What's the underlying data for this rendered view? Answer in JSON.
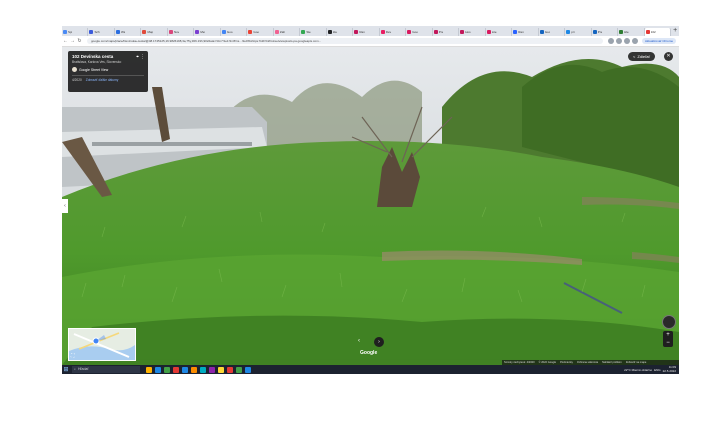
{
  "browser": {
    "tabs": [
      {
        "label": "Spi",
        "color": "#4a8af4",
        "active": false
      },
      {
        "label": "Sch",
        "color": "#3b5bdb",
        "active": false
      },
      {
        "label": "Wa",
        "color": "#2b6ee0",
        "active": false
      },
      {
        "label": "Map",
        "color": "#e04a3b",
        "active": false
      },
      {
        "label": "Nov",
        "color": "#d9467b",
        "active": false
      },
      {
        "label": "Met",
        "color": "#7b3fd1",
        "active": false
      },
      {
        "label": "Goo",
        "color": "#4285f4",
        "active": false
      },
      {
        "label": "Goo",
        "color": "#ea4335",
        "active": false
      },
      {
        "label": "Zah",
        "color": "#f06292",
        "active": false
      },
      {
        "label": "Sle",
        "color": "#34a853",
        "active": false
      },
      {
        "label": "Ide",
        "color": "#202124",
        "active": false
      },
      {
        "label": "Ran",
        "color": "#c2185b",
        "active": false
      },
      {
        "label": "Dev",
        "color": "#e91e63",
        "active": false
      },
      {
        "label": "Goo",
        "color": "#d81b60",
        "active": false
      },
      {
        "label": "Pre",
        "color": "#c2185b",
        "active": false
      },
      {
        "label": "Hos",
        "color": "#c2185b",
        "active": false
      },
      {
        "label": "Lite",
        "color": "#d81b60",
        "active": false
      },
      {
        "label": "Ran",
        "color": "#2962ff",
        "active": false
      },
      {
        "label": "Goo",
        "color": "#1565c0",
        "active": false
      },
      {
        "label": "pri",
        "color": "#1e88e5",
        "active": false
      },
      {
        "label": "Pre",
        "color": "#1565c0",
        "active": false
      },
      {
        "label": "Hle",
        "color": "#2e7d32",
        "active": false
      },
      {
        "label": "102",
        "color": "#e53935",
        "active": true
      }
    ],
    "new_tab": "+",
    "url": "google.com/maps/place/Devínska+cesta/@48.1745125,16.9826198,3a,75y,306.19h,90t/data=!3m7!1e1!3m5!1s...!2e0!6shttps:%2F%2Fstreetviewpixels-pa.googleapis.com...",
    "back": "←",
    "forward": "→",
    "reload": "↻",
    "extension_label": "Aktualizovať Chrome"
  },
  "infocard": {
    "title": "102 Devínska cesta",
    "subtitle": "Bratislava, Karlova Ves, Slovensko",
    "source": "Google Street View",
    "date": "4/2020",
    "more": "Zobraziť ďalšie dátumy",
    "pin": "⌖",
    "menu": "⋮"
  },
  "controls": {
    "share": "Zdieľať",
    "share_icon": "<",
    "close": "✕",
    "left_arrow": "‹",
    "nav_left": "‹",
    "nav_right": "›",
    "zoom_in": "+",
    "zoom_out": "−",
    "expand_icon": "⛶",
    "google_logo": "Google"
  },
  "footer": [
    "Snímky zachytené: 4/2020",
    "© 2022 Google",
    "Podmienky",
    "Ochrana súkromia",
    "Nahlásiť problém",
    "Zobraziť na mape"
  ],
  "taskbar": {
    "start": "⊞",
    "search_placeholder": "Hľadať",
    "apps": [
      "#ffb300",
      "#1e88e5",
      "#43a047",
      "#e53935",
      "#1e88e5",
      "#fb8c00",
      "#00acc1",
      "#8e24aa",
      "#fdd835",
      "#e53935",
      "#43a047",
      "#1e88e5"
    ],
    "weather": "22°C  Mierně oblačno",
    "time": "11:09",
    "date": "22.5.2022",
    "lang": "ENG"
  }
}
